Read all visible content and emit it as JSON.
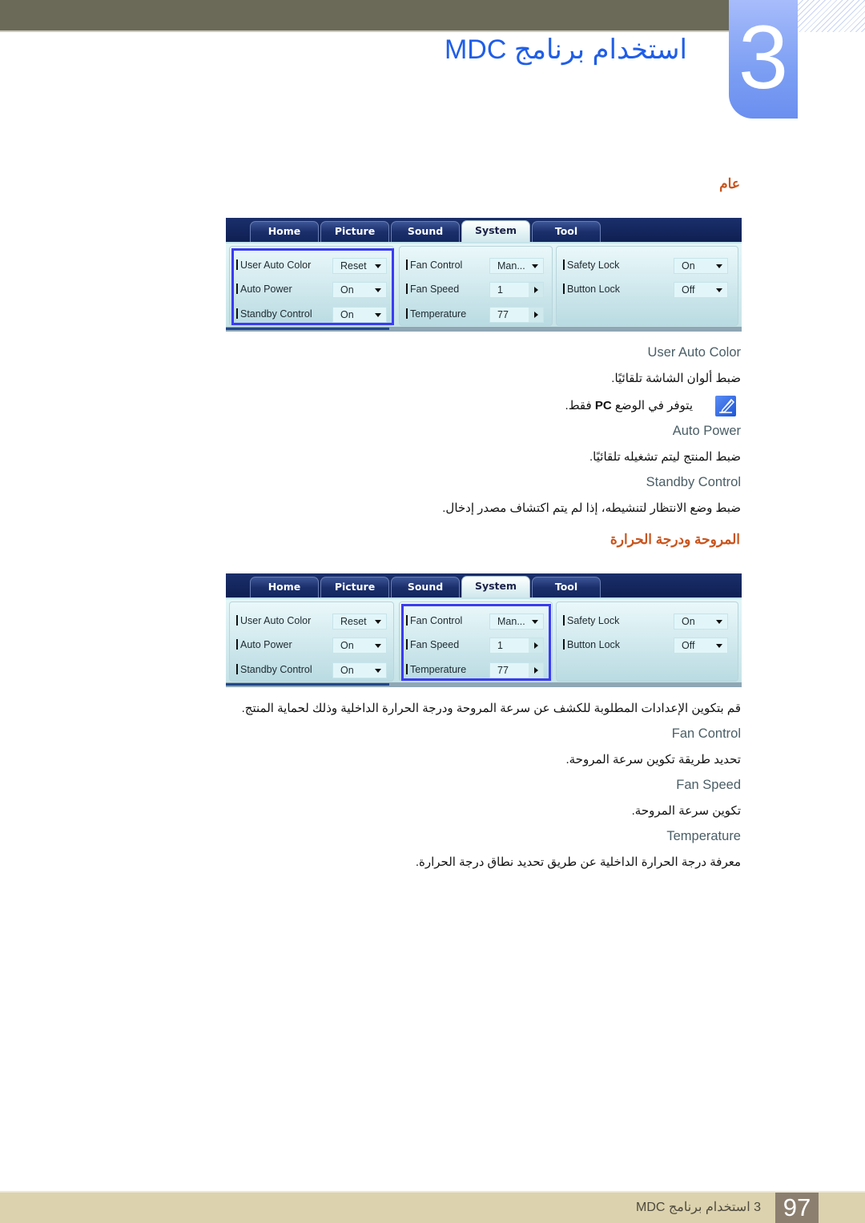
{
  "header": {
    "chapter_number": "3",
    "chapter_title": "استخدام برنامج MDC"
  },
  "sections": [
    {
      "heading": "عام"
    },
    {
      "heading": "المروحة ودرجة الحرارة"
    }
  ],
  "panel": {
    "tabs": [
      {
        "label": "Home"
      },
      {
        "label": "Picture"
      },
      {
        "label": "Sound"
      },
      {
        "label": "System",
        "active": true
      },
      {
        "label": "Tool"
      }
    ],
    "groups": {
      "display": [
        {
          "label": "User Auto Color",
          "value": "Reset",
          "control": "dropdown"
        },
        {
          "label": "Auto Power",
          "value": "On",
          "control": "dropdown"
        },
        {
          "label": "Standby Control",
          "value": "On",
          "control": "dropdown"
        }
      ],
      "fan": [
        {
          "label": "Fan Control",
          "value": "Man...",
          "control": "dropdown"
        },
        {
          "label": "Fan Speed",
          "value": "1",
          "control": "stepper"
        },
        {
          "label": "Temperature",
          "value": "77",
          "control": "stepper"
        }
      ],
      "lock": [
        {
          "label": "Safety Lock",
          "value": "On",
          "control": "dropdown"
        },
        {
          "label": "Button Lock",
          "value": "Off",
          "control": "dropdown"
        }
      ]
    }
  },
  "general_items": [
    {
      "term": "User Auto Color",
      "description": "ضبط ألوان الشاشة تلقائيًا."
    },
    {
      "term": "Auto Power",
      "description": "ضبط المنتج ليتم تشغيله تلقائيًا."
    },
    {
      "term": "Standby Control",
      "description": "ضبط وضع الانتظار لتنشيطه، إذا لم يتم اكتشاف مصدر إدخال."
    }
  ],
  "note": {
    "icon": "note-pencil-icon",
    "text_before": "يتوفر في الوضع ",
    "text_bold": "PC",
    "text_after": " فقط."
  },
  "fan_intro": "قم بتكوين الإعدادات المطلوبة للكشف عن سرعة المروحة ودرجة الحرارة الداخلية وذلك لحماية المنتج.",
  "fan_items": [
    {
      "term": "Fan Control",
      "description": "تحديد طريقة تكوين سرعة المروحة."
    },
    {
      "term": "Fan Speed",
      "description": "تكوين سرعة المروحة."
    },
    {
      "term": "Temperature",
      "description": "معرفة درجة الحرارة الداخلية عن طريق تحديد نطاق درجة الحرارة."
    }
  ],
  "footer": {
    "page_number": "97",
    "chapter_text": "3 استخدام برنامج MDC"
  },
  "colors": {
    "accent_blue": "#1f5ee8",
    "heading_orange": "#c9541c",
    "highlight": "#3b3bf2",
    "header_bar": "#6b6a58",
    "footer_bar": "#dcd2ae"
  }
}
